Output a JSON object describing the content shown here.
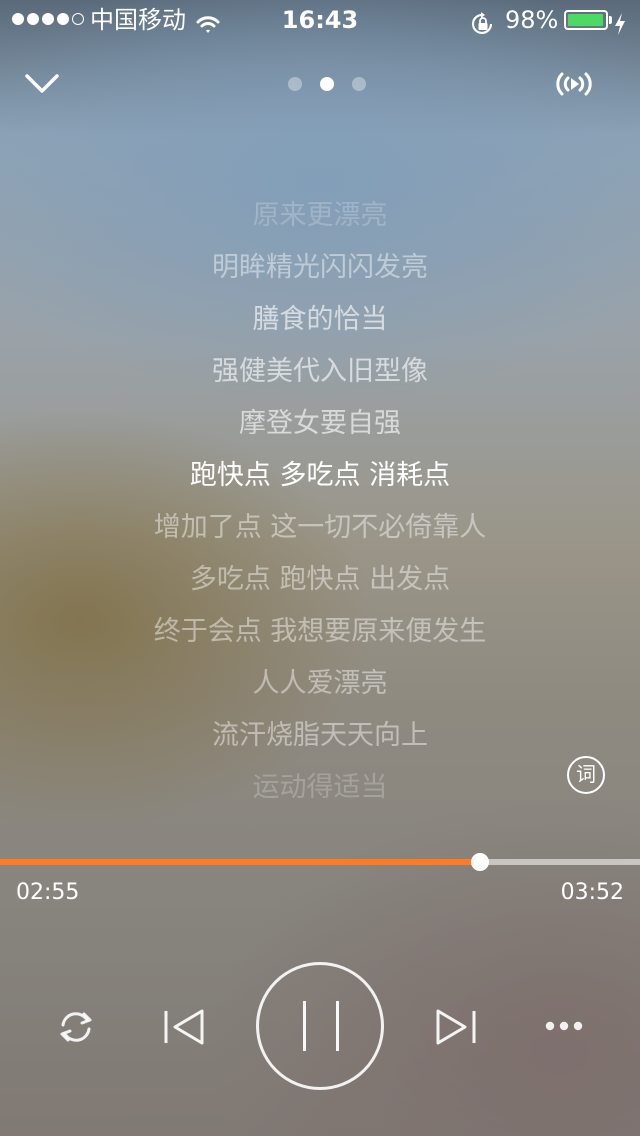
{
  "status_bar": {
    "carrier": "中国移动",
    "time": "16:43",
    "battery_percent": "98%",
    "battery_level": 0.98,
    "battery_color": "#4cd964"
  },
  "nav": {
    "collapse_icon": "chevron-down-icon",
    "airplay_icon": "airplay-icon",
    "pages": {
      "count": 3,
      "active_index": 1
    }
  },
  "lyrics": [
    {
      "text": "原来更漂亮",
      "state": "faint"
    },
    {
      "text": "明眸精光闪闪发亮",
      "state": "dim"
    },
    {
      "text": "膳食的恰当",
      "state": "near"
    },
    {
      "text": "强健美代入旧型像",
      "state": "near"
    },
    {
      "text": "摩登女要自强",
      "state": "near"
    },
    {
      "text": "跑快点 多吃点 消耗点",
      "state": "current"
    },
    {
      "text": "增加了点 这一切不必倚靠人",
      "state": "dim"
    },
    {
      "text": "多吃点 跑快点 出发点",
      "state": "dim"
    },
    {
      "text": "终于会点 我想要原来便发生",
      "state": "dim"
    },
    {
      "text": "人人爱漂亮",
      "state": "dim"
    },
    {
      "text": "流汗烧脂天天向上",
      "state": "dim"
    },
    {
      "text": "运动得适当",
      "state": "faint"
    }
  ],
  "lyrics_button_label": "词",
  "playback": {
    "elapsed": "02:55",
    "total": "03:52",
    "progress": 0.75,
    "accent_color": "#ff7a22"
  },
  "controls": {
    "repeat_icon": "repeat-icon",
    "prev_icon": "previous-track-icon",
    "pause_icon": "pause-icon",
    "next_icon": "next-track-icon",
    "more_icon": "more-icon"
  }
}
